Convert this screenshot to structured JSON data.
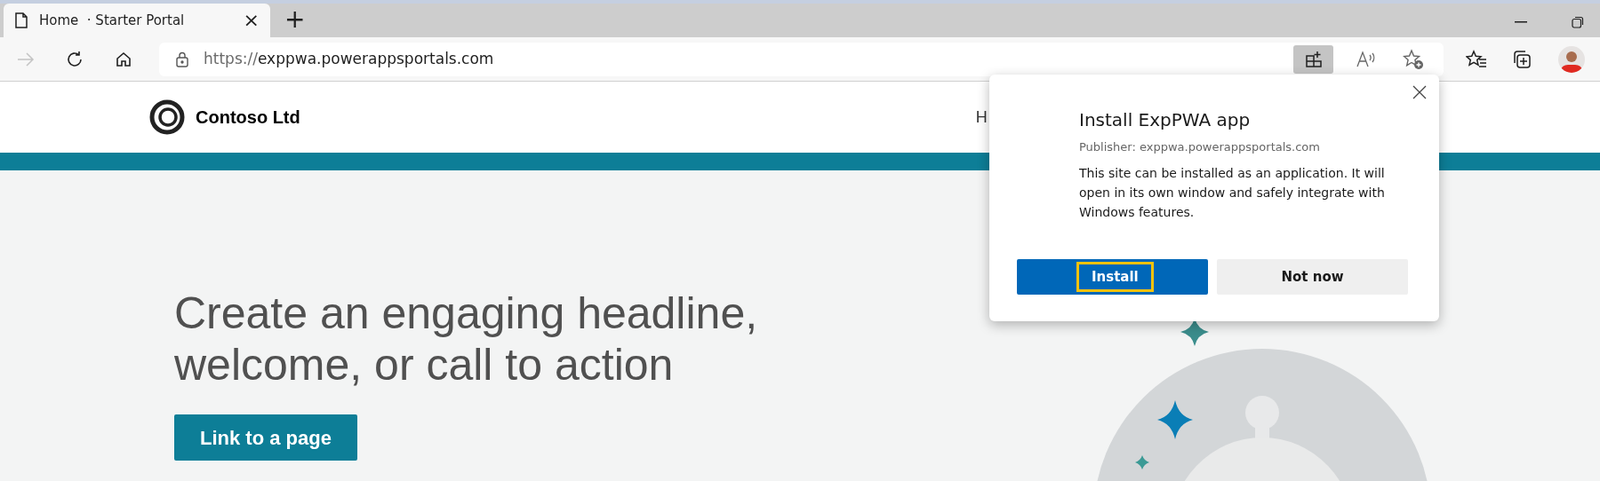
{
  "tab": {
    "title": "Home  · Starter Portal",
    "close": "×",
    "new_tab": "+"
  },
  "address_bar": {
    "scheme": "https://",
    "host": "exppwa.powerappsportals.com"
  },
  "toolbar": {
    "app_available_active": true
  },
  "site": {
    "brand": "Contoso Ltd",
    "nav_item": "H",
    "headline": "Create an engaging headline, welcome, or call to action",
    "cta": "Link to a page"
  },
  "install_popup": {
    "title": "Install ExpPWA app",
    "publisher": "Publisher: exppwa.powerappsportals.com",
    "message": "This site can be installed as an application. It will open in its own window and safely integrate with Windows features.",
    "buttons": [
      {
        "label": "Install",
        "kind": "primary",
        "focused": true
      },
      {
        "label": "Not now",
        "kind": "secondary",
        "focused": false
      }
    ]
  }
}
